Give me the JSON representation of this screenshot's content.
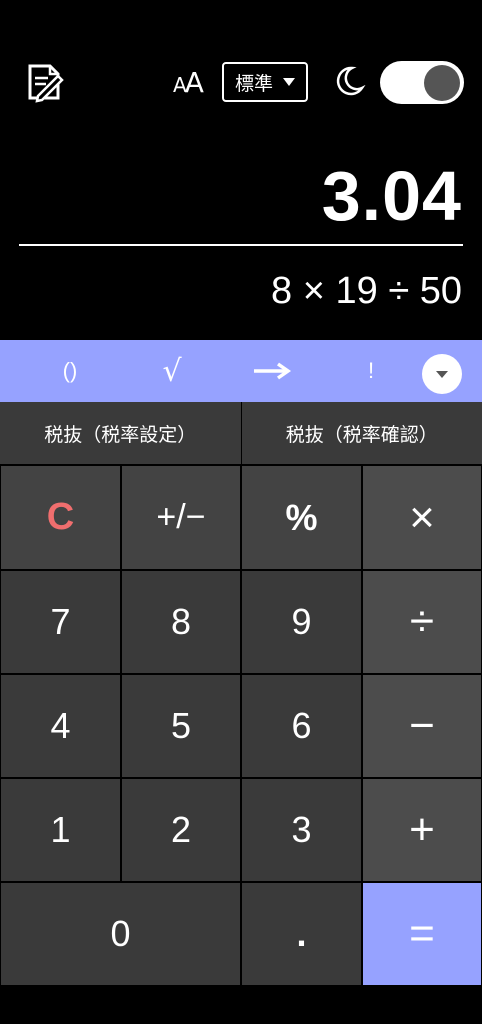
{
  "header": {
    "memo_icon": "note-edit-icon",
    "fontsize_label_small": "A",
    "fontsize_label_large": "A",
    "mode_value": "標準",
    "moon_icon": "moon-icon",
    "dark_mode_on": true
  },
  "display": {
    "result": "3.04",
    "expression": "8 × 19 ÷ 50"
  },
  "function_bar": {
    "keys": [
      "()",
      "√",
      "→",
      "!"
    ],
    "expand_icon": "chevron-down-icon"
  },
  "tax_row": {
    "left": "税抜（税率設定）",
    "right": "税抜（税率確認）"
  },
  "keypad": {
    "clear": "C",
    "plus_minus": "+/−",
    "percent": "%",
    "multiply": "×",
    "seven": "7",
    "eight": "8",
    "nine": "9",
    "divide": "÷",
    "four": "4",
    "five": "5",
    "six": "6",
    "minus": "−",
    "one": "1",
    "two": "2",
    "three": "3",
    "plus": "+",
    "zero": "0",
    "decimal": ".",
    "equals": "="
  },
  "colors": {
    "accent": "#96a2ff",
    "clear_red": "#f06e6e",
    "key_dark": "#3a3a3a",
    "key_mid": "#434343",
    "key_op": "#4c4c4c"
  }
}
